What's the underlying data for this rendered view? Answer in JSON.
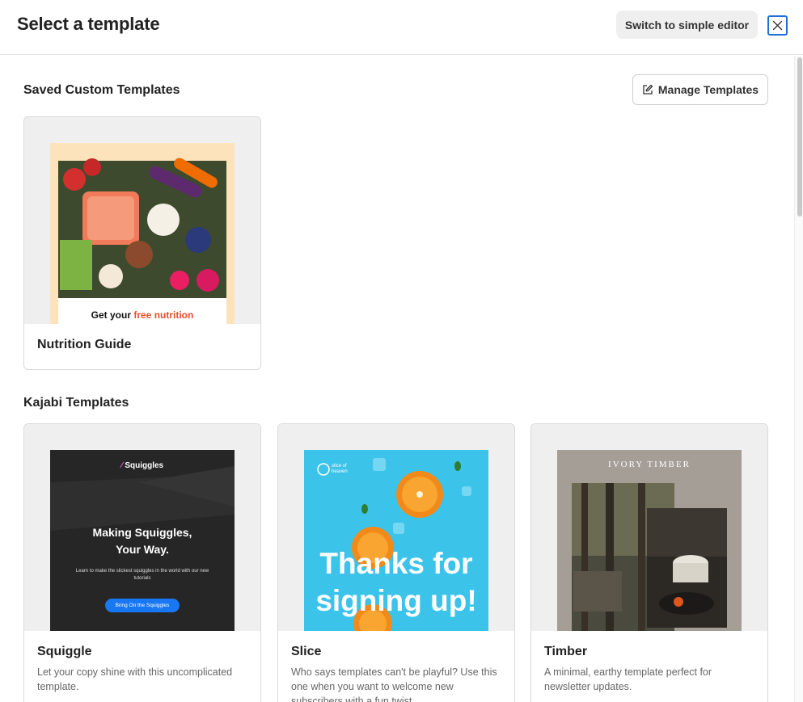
{
  "header": {
    "title": "Select a template",
    "simple_editor_label": "Switch to simple editor"
  },
  "saved": {
    "title": "Saved Custom Templates",
    "manage_label": "Manage Templates",
    "templates": [
      {
        "name": "Nutrition Guide",
        "preview_text_a": "Get your ",
        "preview_text_b": "free nutrition"
      }
    ]
  },
  "kajabi": {
    "title": "Kajabi Templates",
    "templates": [
      {
        "name": "Squiggle",
        "description": "Let your copy shine with this uncomplicated template.",
        "preview": {
          "brand": "Squiggles",
          "headline_1": "Making Squiggles,",
          "headline_2": "Your Way.",
          "body": "Learn to make the slickest squiggles in the world with our new tutorials",
          "cta": "Bring On the Squiggles"
        }
      },
      {
        "name": "Slice",
        "description": "Who says templates can't be playful? Use this one when you want to welcome new subscribers with a fun twist.",
        "preview": {
          "brand_1": "slice of",
          "brand_2": "heaven",
          "headline_1": "Thanks for",
          "headline_2": "signing up!"
        }
      },
      {
        "name": "Timber",
        "description": "A minimal, earthy template perfect for newsletter updates.",
        "preview": {
          "brand": "IVORY TIMBER"
        }
      }
    ]
  },
  "colors": {
    "accent": "#1d6fd8",
    "squiggle_cta": "#1877f2",
    "slice_bg": "#3cc3ea",
    "timber_bg": "#a59e96",
    "nutrition_bg": "#fde3bc",
    "nutrition_red": "#e94e2a"
  },
  "icons": [
    "close-icon",
    "edit-icon",
    "scrollbar"
  ]
}
